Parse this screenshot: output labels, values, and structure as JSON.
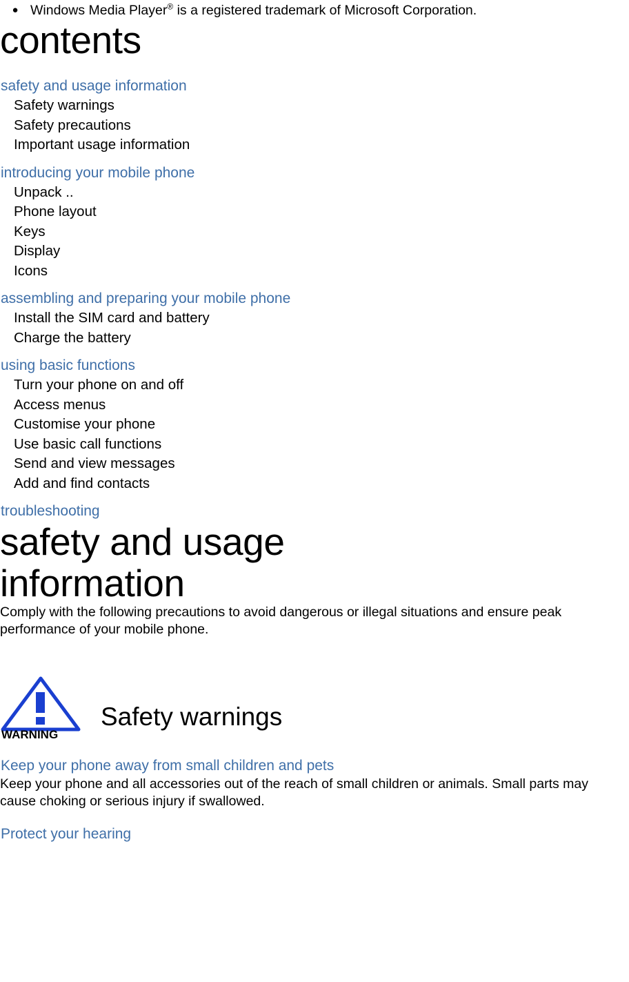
{
  "trademark": {
    "bullet": "●",
    "text_before": "Windows Media Player",
    "superscript": "®",
    "text_after": " is a registered trademark of Microsoft Corporation."
  },
  "contents": {
    "heading": "contents",
    "groups": [
      {
        "section": "safety and usage information",
        "entries": [
          "Safety warnings",
          "Safety precautions",
          "Important usage information"
        ]
      },
      {
        "section": "introducing your mobile phone",
        "entries": [
          "Unpack  ..",
          "Phone layout",
          "Keys",
          "Display",
          "Icons"
        ]
      },
      {
        "section": "assembling and preparing your mobile phone",
        "entries": [
          "Install the SIM card and battery",
          "Charge the battery"
        ]
      },
      {
        "section": "using basic functions",
        "entries": [
          "Turn your phone on and off",
          "Access menus",
          "Customise your phone",
          "Use basic call functions",
          "Send and view messages",
          "Add and find contacts"
        ]
      },
      {
        "section": "troubleshooting",
        "entries": []
      }
    ]
  },
  "safety": {
    "heading": "safety and usage information",
    "intro": "Comply with the following precautions to avoid dangerous or illegal situations and ensure peak performance of your mobile phone.",
    "warning_icon_label": "WARNING",
    "warnings_title": "Safety warnings",
    "sub_heading_1": "Keep your phone away from small children and pets",
    "body_1": "Keep your phone and all accessories out of the reach of small children or animals. Small parts may cause choking or serious injury if swallowed.",
    "sub_heading_2": "Protect your hearing"
  },
  "colors": {
    "accent_blue": "#3f6fa8",
    "warning_blue": "#1a3fd0",
    "text": "#000000",
    "background": "#ffffff"
  }
}
